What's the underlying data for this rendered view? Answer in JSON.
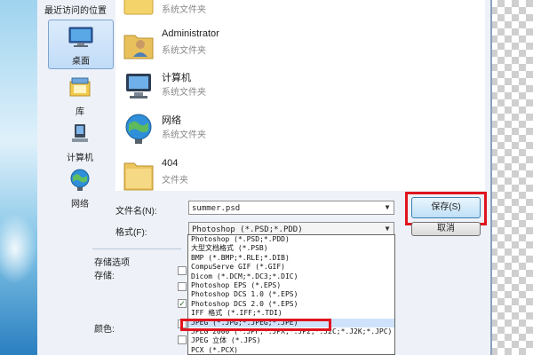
{
  "dialog": {
    "recent_label": "最近访问的位置",
    "nav": [
      {
        "label": "桌面",
        "icon": "desktop-icon"
      },
      {
        "label": "库",
        "icon": "library-icon"
      },
      {
        "label": "计算机",
        "icon": "computer-icon"
      },
      {
        "label": "网络",
        "icon": "network-icon"
      }
    ],
    "files": [
      {
        "name": "",
        "type": "系统文件夹",
        "icon": "libraries-icon"
      },
      {
        "name": "Administrator",
        "type": "系统文件夹",
        "icon": "user-folder-icon"
      },
      {
        "name": "计算机",
        "type": "系统文件夹",
        "icon": "computer-icon"
      },
      {
        "name": "网络",
        "type": "系统文件夹",
        "icon": "network-icon"
      },
      {
        "name": "404",
        "type": "文件夹",
        "icon": "folder-icon"
      }
    ],
    "filename_label": "文件名(N):",
    "filename_value": "summer.psd",
    "format_label": "格式(F):",
    "format_value": "Photoshop (*.PSD;*.PDD)",
    "save_button": "保存(S)",
    "cancel_button": "取消",
    "storage_options_label": "存储选项",
    "storage_label": "存储:",
    "color_label": "颜色:",
    "format_options": [
      "Photoshop (*.PSD;*.PDD)",
      "大型文档格式 (*.PSB)",
      "BMP (*.BMP;*.RLE;*.DIB)",
      "CompuServe GIF (*.GIF)",
      "Dicom (*.DCM;*.DC3;*.DIC)",
      "Photoshop EPS (*.EPS)",
      "Photoshop DCS 1.0 (*.EPS)",
      "Photoshop DCS 2.0 (*.EPS)",
      "IFF 格式 (*.IFF;*.TDI)",
      "JPEG (*.JPG;*.JPEG;*.JPE)",
      "JPEG 2000 (*.JPF;*.JPX;*.JP2;*.J2C;*.J2K;*.JPC)",
      "JPEG 立体 (*.JPS)",
      "PCX (*.PCX)"
    ],
    "highlighted_option_index": 9
  },
  "colors": {
    "highlight_box": "#e0141e",
    "dialog_bg": "#eef2f8"
  }
}
